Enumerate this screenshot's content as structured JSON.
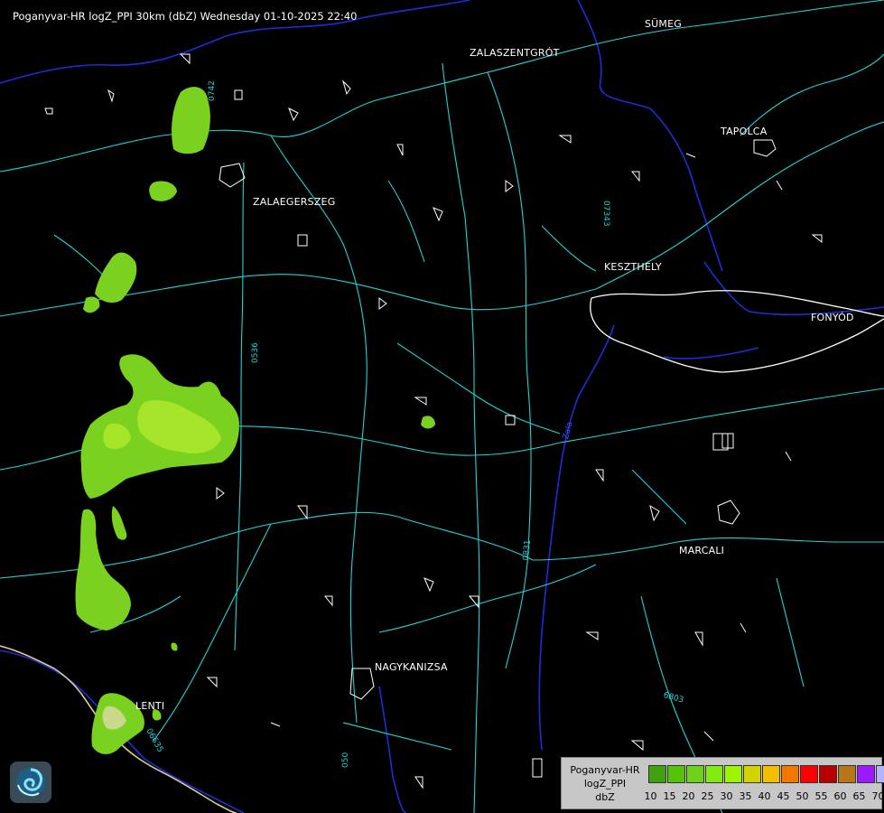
{
  "header": {
    "title": "Poganyvar-HR logZ_PPI 30km (dbZ) Wednesday 01-10-2025 22:40"
  },
  "cities": [
    {
      "name": "SÜMEG"
    },
    {
      "name": "ZALASZENTGRÓT"
    },
    {
      "name": "TAPOLCA"
    },
    {
      "name": "ZALAEGERSZEG"
    },
    {
      "name": "KESZTHELY"
    },
    {
      "name": "FONYÓD"
    },
    {
      "name": "MARCALI"
    },
    {
      "name": "NAGYKANIZSA"
    },
    {
      "name": "LENTI"
    }
  ],
  "road_labels": [
    {
      "text": "07343"
    },
    {
      "text": "0536"
    },
    {
      "text": "0831"
    },
    {
      "text": "6803"
    },
    {
      "text": "06635"
    },
    {
      "text": "050"
    },
    {
      "text": "0742"
    },
    {
      "text": "Zala"
    }
  ],
  "legend": {
    "title_lines": [
      "Poganyvar-HR",
      "logZ_PPI",
      "dbZ"
    ],
    "labels": [
      "10",
      "15",
      "20",
      "25",
      "30",
      "35",
      "40",
      "45",
      "50",
      "55",
      "60",
      "65",
      "70"
    ],
    "colors": [
      "#3fa10b",
      "#55c30a",
      "#6ed21d",
      "#84ea14",
      "#9ff500",
      "#d2d300",
      "#f2be00",
      "#f27800",
      "#ff0000",
      "#b60000",
      "#b8761a",
      "#9b1bff",
      "#b3b3ff"
    ]
  },
  "colors": {
    "background": "#000000",
    "roads": "#22d3d3",
    "water": "#1d2ed8",
    "borders": "#ffffff",
    "echo_light": "#7bd11f",
    "echo_medium": "#a6e52a"
  }
}
